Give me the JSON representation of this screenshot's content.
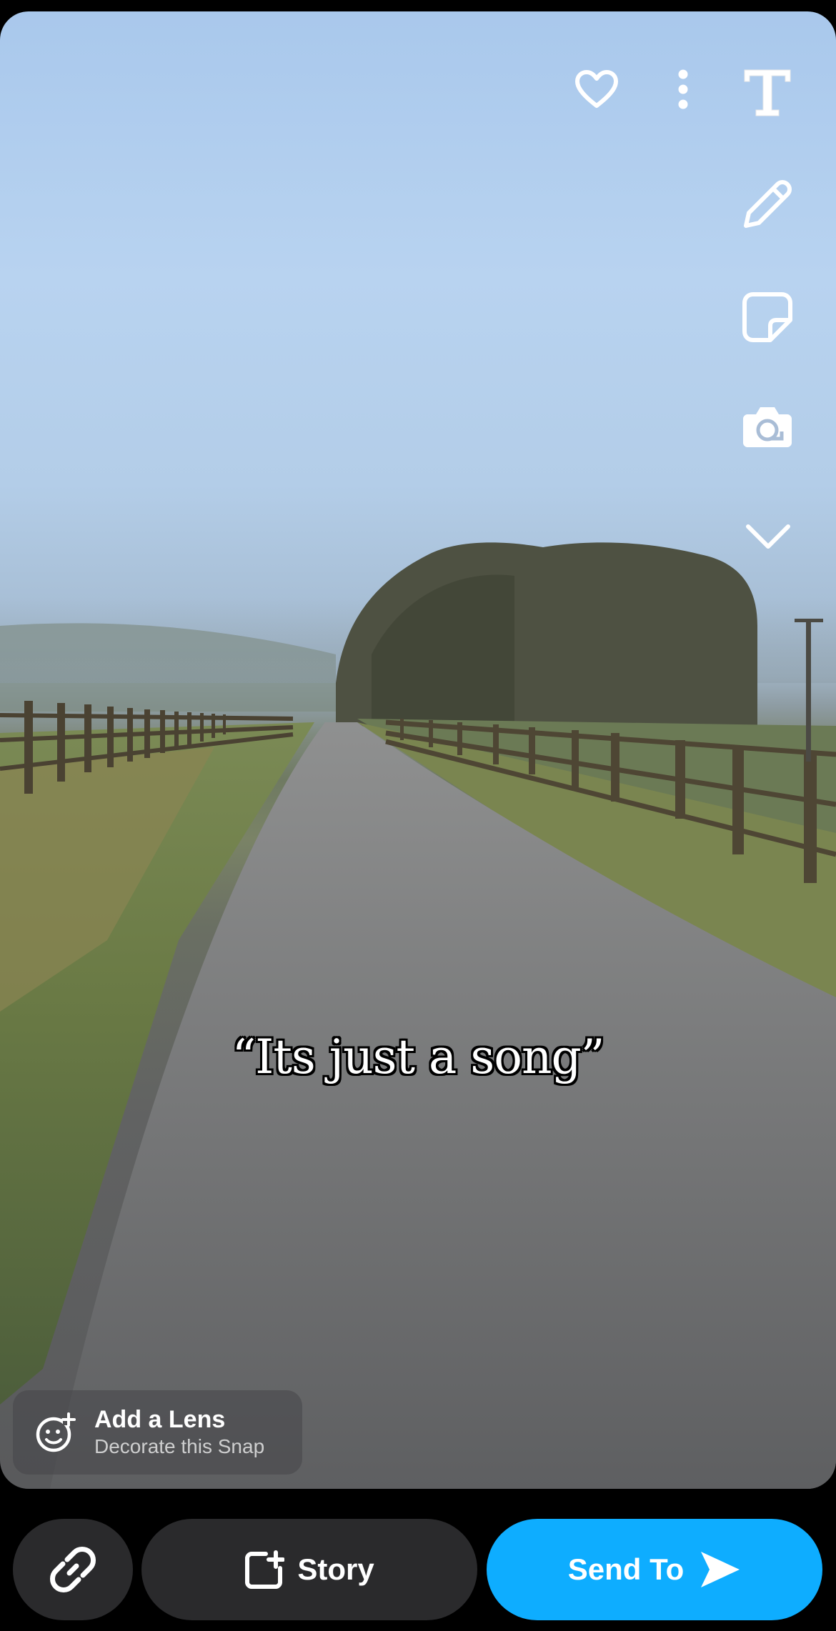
{
  "header": {
    "icons": [
      "heart-icon",
      "more-vert-icon",
      "text-tool-icon",
      "pencil-icon",
      "sticker-icon",
      "camera-rotate-icon",
      "chevron-down-icon"
    ]
  },
  "caption": {
    "text": "“Its just a song”"
  },
  "lens": {
    "title": "Add a Lens",
    "subtitle": "Decorate this Snap",
    "icon": "add-lens-icon"
  },
  "bottom_bar": {
    "link_icon": "link-icon",
    "story_label": "Story",
    "story_icon": "add-story-icon",
    "send_label": "Send To",
    "send_icon": "send-arrow-icon",
    "send_color": "#0eadff"
  }
}
